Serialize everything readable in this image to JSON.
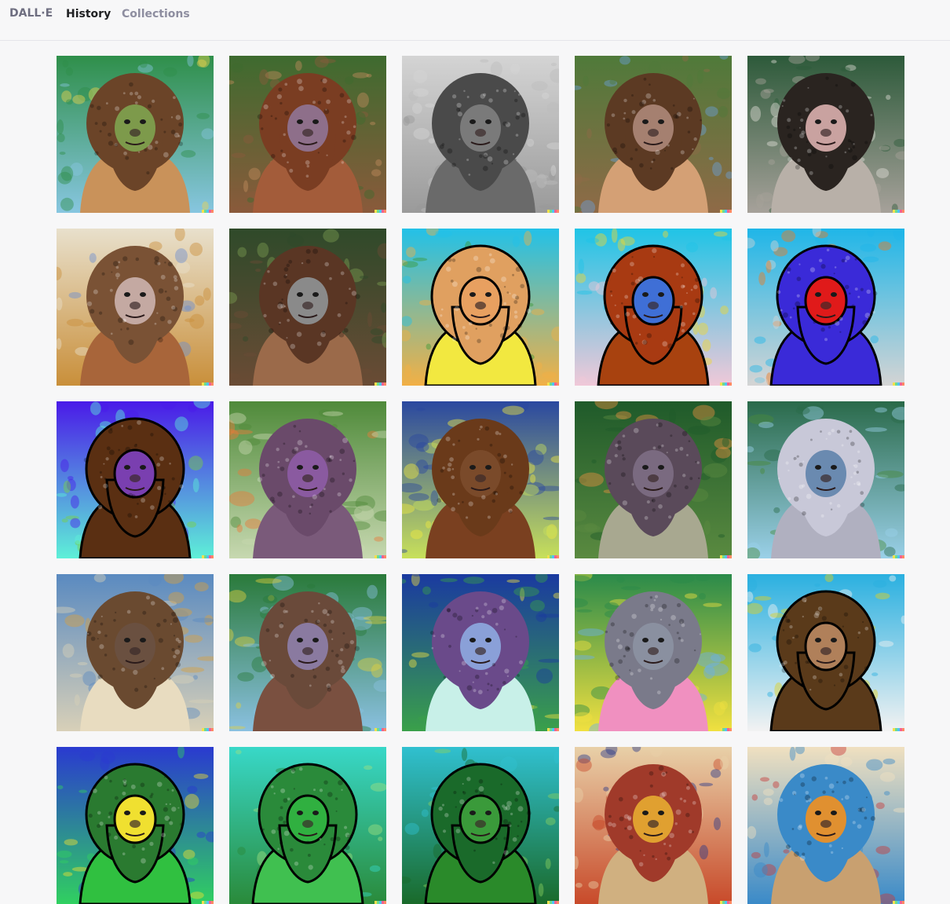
{
  "nav": {
    "brand": "DALL·E",
    "links": [
      {
        "label": "History",
        "active": true
      },
      {
        "label": "Collections",
        "active": false
      }
    ]
  },
  "gallery": {
    "images": [
      {
        "style": "mosaic",
        "bg": [
          "#2f8f4a",
          "#87c6e0"
        ],
        "fur": "#6b4428",
        "face": "#7d9a4b",
        "body": "#c9925a",
        "accent": "#e8d24d"
      },
      {
        "style": "mosaic",
        "bg": [
          "#3e6b2f",
          "#8a5a3b"
        ],
        "fur": "#7a3d22",
        "face": "#8e6f8a",
        "body": "#a35c3a",
        "accent": "#c08b5d"
      },
      {
        "style": "sketch",
        "bg": [
          "#d4d4d4",
          "#9a9a9a"
        ],
        "fur": "#4a4a4a",
        "face": "#7a7a7a",
        "body": "#6a6a6a",
        "accent": "#bdbdbd"
      },
      {
        "style": "mosaic",
        "bg": [
          "#4f7a3a",
          "#8f6a47"
        ],
        "fur": "#5c3a23",
        "face": "#a58070",
        "body": "#d4a075",
        "accent": "#6ba0d8"
      },
      {
        "style": "mosaic",
        "bg": [
          "#2d5a3a",
          "#a6a19a"
        ],
        "fur": "#2a2420",
        "face": "#c9a2a0",
        "body": "#b8b0a8",
        "accent": "#e0ddd8"
      },
      {
        "style": "mosaic",
        "bg": [
          "#e8e0cc",
          "#c98f3a"
        ],
        "fur": "#7a5235",
        "face": "#c4a9a2",
        "body": "#a8653a",
        "accent": "#6d8fd0"
      },
      {
        "style": "mosaic",
        "bg": [
          "#2f4a2a",
          "#6a4b35"
        ],
        "fur": "#5a3624",
        "face": "#8a8a8a",
        "body": "#9b6a4a",
        "accent": "#7b9c50"
      },
      {
        "style": "cartoon",
        "bg": [
          "#22c1e8",
          "#f2b045"
        ],
        "fur": "#e0a060",
        "face": "#e8a060",
        "body": "#f2e840",
        "accent": "#3a9a3a"
      },
      {
        "style": "cartoon",
        "bg": [
          "#1fc4e6",
          "#f0c8d8"
        ],
        "fur": "#a83a12",
        "face": "#3f6fd6",
        "body": "#a8420f",
        "accent": "#f0d830"
      },
      {
        "style": "cartoon",
        "bg": [
          "#1fb6e8",
          "#d4d4d4"
        ],
        "fur": "#3a2ad8",
        "face": "#e01a1a",
        "body": "#3a2ad8",
        "accent": "#f07a20"
      },
      {
        "style": "cartoon",
        "bg": [
          "#4a1ae8",
          "#5ef0d8"
        ],
        "fur": "#5a2f12",
        "face": "#7a3fb0",
        "body": "#5a2f12",
        "accent": "#7ad040"
      },
      {
        "style": "impasto",
        "bg": [
          "#4f8a3a",
          "#c7d8b0"
        ],
        "fur": "#6a4a6a",
        "face": "#8a5aa0",
        "body": "#7a5a7a",
        "accent": "#e87a3a"
      },
      {
        "style": "impasto",
        "bg": [
          "#2a48a0",
          "#c8e05a"
        ],
        "fur": "#6a3a1a",
        "face": "#7a4a2a",
        "body": "#7a4020",
        "accent": "#f0e840"
      },
      {
        "style": "impasto",
        "bg": [
          "#1f5a2a",
          "#5a8a40"
        ],
        "fur": "#5a4a5a",
        "face": "#7a6a80",
        "body": "#a8a890",
        "accent": "#e89040"
      },
      {
        "style": "impasto",
        "bg": [
          "#2a6a4a",
          "#9ad0e8"
        ],
        "fur": "#c8c8d8",
        "face": "#6a8ab0",
        "body": "#b0b0c0",
        "accent": "#4a8a3a"
      },
      {
        "style": "impasto",
        "bg": [
          "#5a8ac0",
          "#d8d0b8"
        ],
        "fur": "#6a4a30",
        "face": "#6a5040",
        "body": "#e8dcc0",
        "accent": "#d8a040"
      },
      {
        "style": "impasto",
        "bg": [
          "#2a7a3a",
          "#8ac0e0"
        ],
        "fur": "#6a4a3a",
        "face": "#8a7aa0",
        "body": "#7a5040",
        "accent": "#e0d040"
      },
      {
        "style": "impasto",
        "bg": [
          "#1a3aa0",
          "#3aa04a"
        ],
        "fur": "#6a4a8a",
        "face": "#8aa0d8",
        "body": "#c8f0e8",
        "accent": "#f0e040"
      },
      {
        "style": "impasto",
        "bg": [
          "#2a8a4a",
          "#f0e040"
        ],
        "fur": "#7a7a8a",
        "face": "#8a90a0",
        "body": "#f090c0",
        "accent": "#6ab0e8"
      },
      {
        "style": "cartoon",
        "bg": [
          "#2ab0e0",
          "#f2f2f2"
        ],
        "fur": "#5a3a1a",
        "face": "#b0805a",
        "body": "#5a3a1a",
        "accent": "#e0d020"
      },
      {
        "style": "cartoon",
        "bg": [
          "#2a3ad0",
          "#30d060"
        ],
        "fur": "#2a7a30",
        "face": "#f0e030",
        "body": "#30c040",
        "accent": "#f0e030"
      },
      {
        "style": "cartoon",
        "bg": [
          "#38d8c8",
          "#2a8a3a"
        ],
        "fur": "#2a8a3a",
        "face": "#30b040",
        "body": "#40c050",
        "accent": "#a0e080"
      },
      {
        "style": "cartoon",
        "bg": [
          "#30c0d0",
          "#1a6a2a"
        ],
        "fur": "#1a6a2a",
        "face": "#3a9a3a",
        "body": "#2a8a2a",
        "accent": "#8ad060"
      },
      {
        "style": "mosaic",
        "bg": [
          "#e8d0a8",
          "#c84a2a"
        ],
        "fur": "#a03a2a",
        "face": "#e0a030",
        "body": "#d0b080",
        "accent": "#2a3a8a"
      },
      {
        "style": "mosaic",
        "bg": [
          "#f0e0c0",
          "#3a8ac8"
        ],
        "fur": "#3a8ac8",
        "face": "#e09030",
        "body": "#c8a070",
        "accent": "#c83a3a"
      }
    ]
  }
}
